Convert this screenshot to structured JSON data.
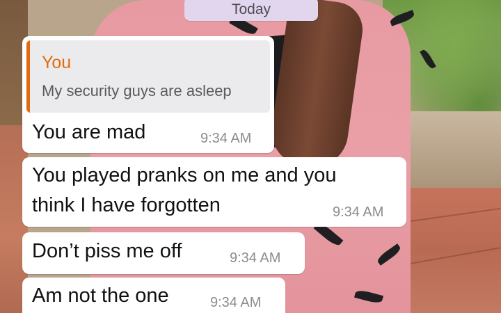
{
  "chat": {
    "date_divider": "Today",
    "messages": [
      {
        "quote": {
          "author": "You",
          "text": "My security guys are asleep"
        },
        "text": "You are mad",
        "time": "9:34 AM"
      },
      {
        "text_lines": [
          "You played pranks on me and you",
          "think I have forgotten"
        ],
        "time": "9:34 AM"
      },
      {
        "text": "Don’t piss me off",
        "time": "9:34 AM"
      },
      {
        "text": "Am not the one",
        "time": "9:34 AM"
      }
    ]
  },
  "colors": {
    "bubble": "#ffffff",
    "date_pill": "#e2d6ef",
    "quote_accent": "#e06c10",
    "quote_bg": "#ebebed",
    "timestamp": "#8c8c90"
  }
}
